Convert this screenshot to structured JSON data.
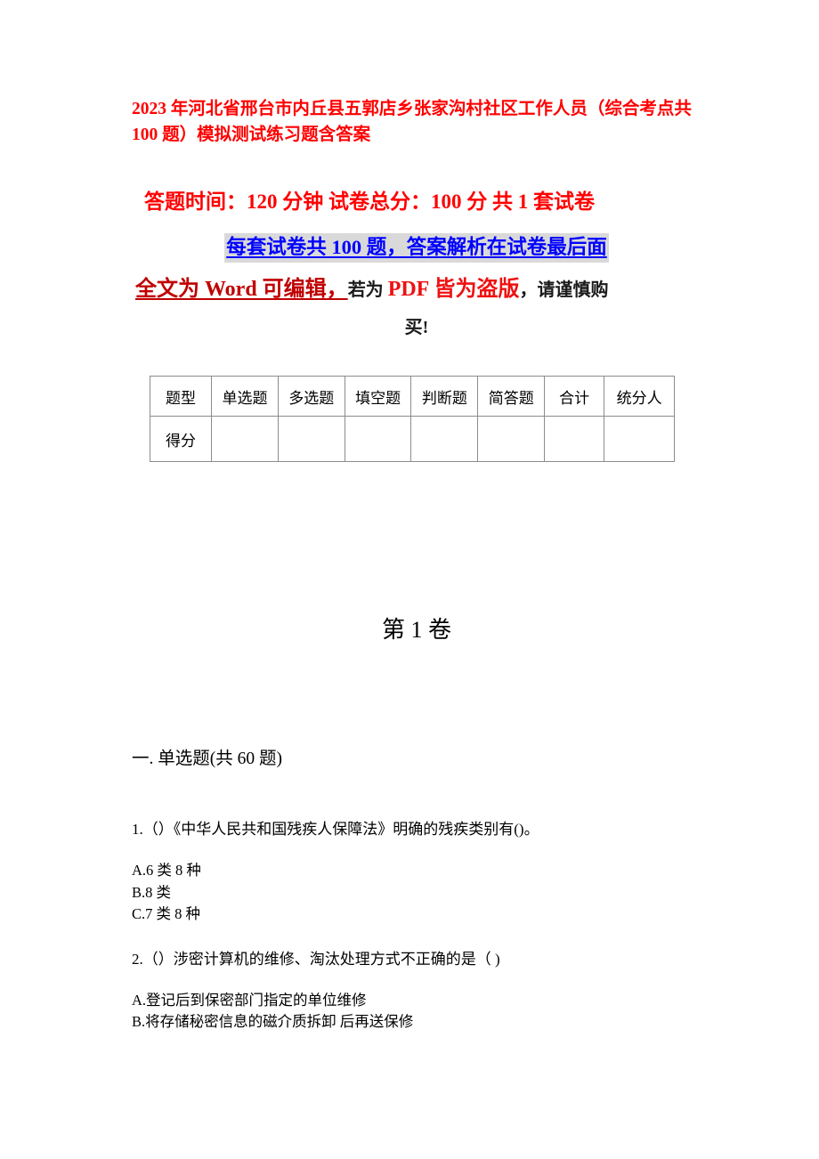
{
  "document": {
    "title": "2023 年河北省邢台市内丘县五郭店乡张家沟村社区工作人员（综合考点共 100 题）模拟测试练习题含答案",
    "info": {
      "line1": "答题时间：120 分钟    试卷总分：100 分    共 1 套试卷",
      "line2": "每套试卷共 100 题，答案解析在试卷最后面",
      "line3_part1": "全文为 Word 可编辑，",
      "line3_part2": "若为 ",
      "line3_part3": "PDF 皆为盗版",
      "line3_part4": "，请谨慎购",
      "line4": "买!"
    },
    "colors": {
      "title_red": "#ff0000",
      "info_red": "#ff0000",
      "highlight_blue": "#0000ff",
      "highlight_bg": "#d9d9d9",
      "dark_red": "#c00000",
      "bright_red": "#ee1111",
      "body_black": "#000000",
      "table_border": "#8c8c8c"
    },
    "score_table": {
      "headers": [
        "题型",
        "单选题",
        "多选题",
        "填空题",
        "判断题",
        "简答题",
        "合计",
        "统分人"
      ],
      "rows": [
        {
          "label": "得分",
          "values": [
            "",
            "",
            "",
            "",
            "",
            "",
            ""
          ]
        }
      ]
    },
    "volume_heading": "第 1 卷",
    "sections": [
      {
        "heading": "一. 单选题(共 60 题)",
        "questions": [
          {
            "stem": "1.（）《中华人民共和国残疾人保障法》明确的残疾类别有()。",
            "options": [
              "A.6 类 8 种",
              "B.8 类",
              "C.7 类 8 种"
            ]
          },
          {
            "stem": "2.（）涉密计算机的维修、淘汰处理方式不正确的是（ )",
            "options": [
              "A.登记后到保密部门指定的单位维修",
              "B.将存储秘密信息的磁介质拆卸 后再送保修"
            ]
          }
        ]
      }
    ]
  }
}
